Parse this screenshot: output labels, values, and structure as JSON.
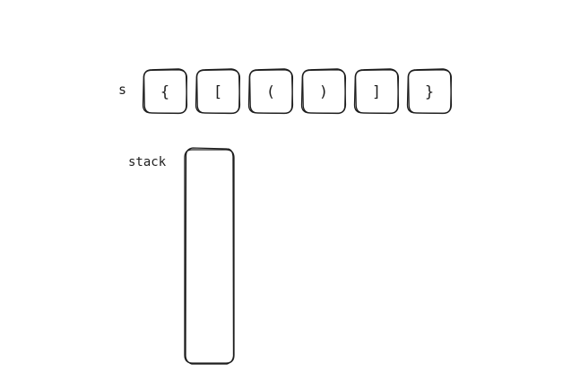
{
  "diagram": {
    "string_label": "s",
    "stack_label": "stack",
    "cells": [
      "{",
      "[",
      "(",
      ")",
      "]",
      "}"
    ],
    "stroke_color": "#1e1e1e",
    "background_color": "#ffffff"
  }
}
